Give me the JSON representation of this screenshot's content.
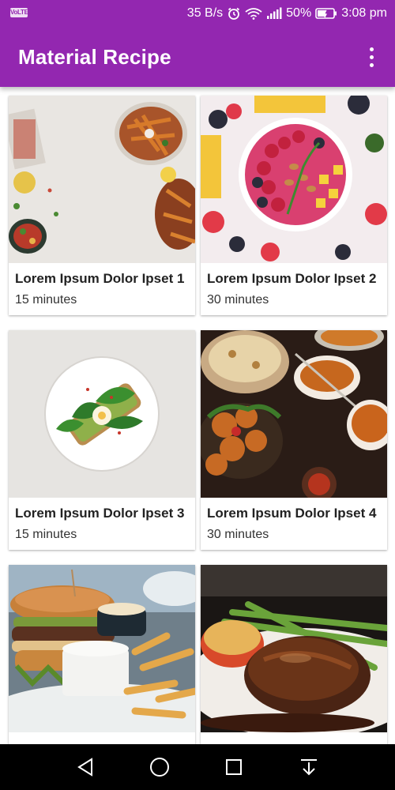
{
  "status_bar": {
    "left_badge": "VoLTE",
    "net_speed": "35 B/s",
    "battery": "50%",
    "time": "3:08 pm",
    "icons": [
      "alarm-icon",
      "wifi-icon",
      "signal-icon",
      "battery-icon"
    ]
  },
  "app_bar": {
    "title": "Material Recipe",
    "overflow_icon": "more-vert-icon",
    "color": "#9327b0"
  },
  "recipes": [
    {
      "title": "Lorem Ipsum Dolor Ipset 1",
      "duration": "15 minutes",
      "image": "fries-and-bowls-photo"
    },
    {
      "title": "Lorem Ipsum Dolor Ipset 2",
      "duration": "30 minutes",
      "image": "smoothie-bowl-photo"
    },
    {
      "title": "Lorem Ipsum Dolor Ipset 3",
      "duration": "15 minutes",
      "image": "avocado-toast-photo"
    },
    {
      "title": "Lorem Ipsum Dolor Ipset 4",
      "duration": "30 minutes",
      "image": "curry-spread-photo"
    },
    {
      "image": "burger-and-fries-photo"
    },
    {
      "image": "steak-with-asparagus-photo"
    }
  ],
  "nav_bar": {
    "buttons": [
      "back-icon",
      "home-icon",
      "recents-icon",
      "notification-pull-icon"
    ]
  }
}
